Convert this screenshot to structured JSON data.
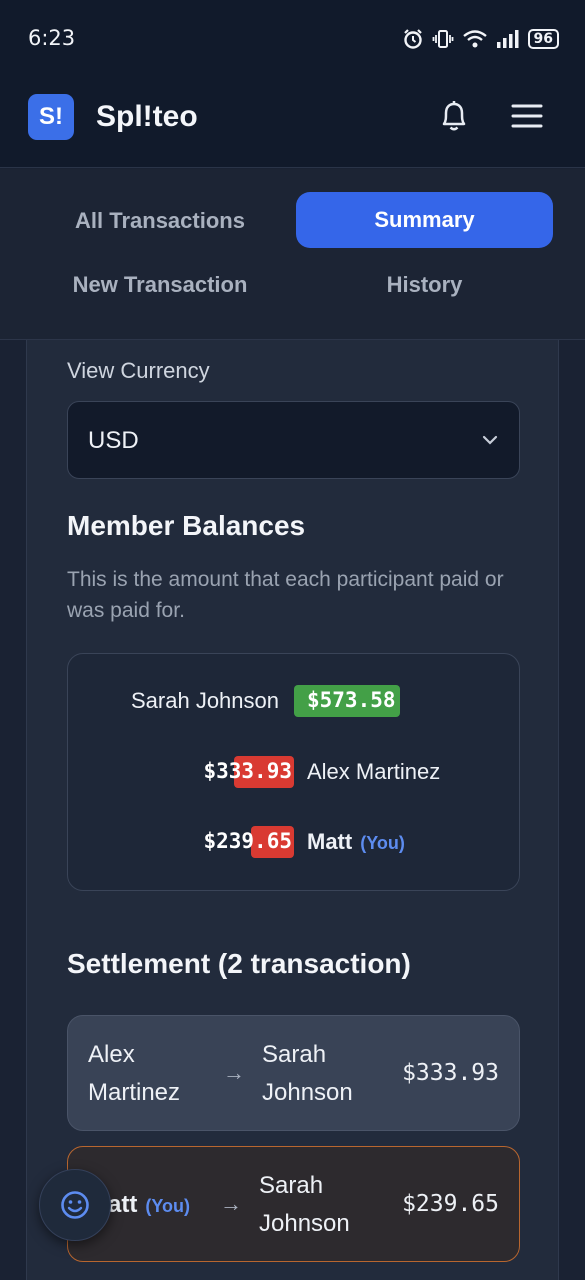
{
  "status_bar": {
    "time": "6:23",
    "battery": "96"
  },
  "app": {
    "logo_text": "S!",
    "name": "Spl!teo"
  },
  "tabs": [
    {
      "label": "All Transactions",
      "active": false
    },
    {
      "label": "Summary",
      "active": true
    },
    {
      "label": "New Transaction",
      "active": false
    },
    {
      "label": "History",
      "active": false
    }
  ],
  "currency": {
    "label": "View Currency",
    "value": "USD"
  },
  "balances": {
    "title": "Member Balances",
    "description": "This is the amount that each participant paid or was paid for.",
    "members": [
      {
        "name": "Sarah Johnson",
        "amount": "$573.58",
        "direction": "positive",
        "you": ""
      },
      {
        "name": "Alex Martinez",
        "amount": "$333.93",
        "direction": "negative",
        "you": ""
      },
      {
        "name": "Matt",
        "amount": "$239.65",
        "direction": "negative",
        "you": "(You)"
      }
    ],
    "colors": {
      "positive": "#43a047",
      "negative": "#d93a32"
    }
  },
  "settlement": {
    "title": "Settlement (2 transaction)",
    "rows": [
      {
        "from_line1": "Alex",
        "from_line2": "Martinez",
        "you": "",
        "to_line1": "Sarah",
        "to_line2": "Johnson",
        "amount": "$333.93"
      },
      {
        "from_line1": "Matt",
        "from_line2": "",
        "you": "(You)",
        "to_line1": "Sarah",
        "to_line2": "Johnson",
        "amount": "$239.65"
      }
    ]
  }
}
